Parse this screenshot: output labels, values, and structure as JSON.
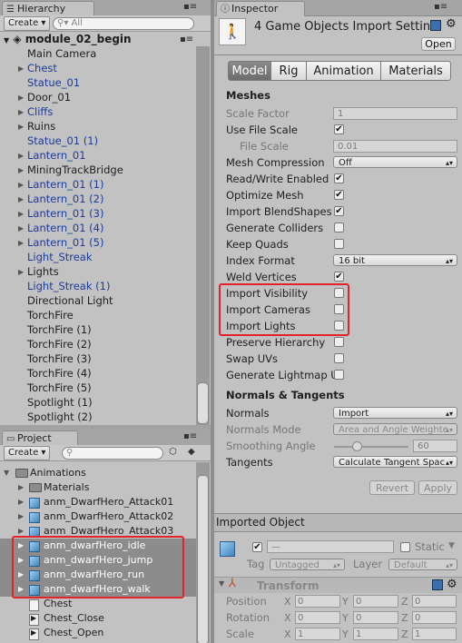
{
  "hierarchy": {
    "tab": "Hierarchy",
    "create": "Create",
    "search_placeholder": "All",
    "scene": "module_02_begin",
    "items": [
      {
        "label": "Main Camera",
        "blue": false,
        "arrow": false,
        "indent": 1
      },
      {
        "label": "Chest",
        "blue": true,
        "arrow": true,
        "indent": 1
      },
      {
        "label": "Statue_01",
        "blue": true,
        "arrow": false,
        "indent": 1
      },
      {
        "label": "Door_01",
        "blue": false,
        "arrow": true,
        "indent": 1
      },
      {
        "label": "Cliffs",
        "blue": true,
        "arrow": true,
        "indent": 1
      },
      {
        "label": "Ruins",
        "blue": false,
        "arrow": true,
        "indent": 1
      },
      {
        "label": "Statue_01 (1)",
        "blue": true,
        "arrow": false,
        "indent": 1
      },
      {
        "label": "Lantern_01",
        "blue": true,
        "arrow": true,
        "indent": 1
      },
      {
        "label": "MiningTrackBridge",
        "blue": false,
        "arrow": true,
        "indent": 1
      },
      {
        "label": "Lantern_01 (1)",
        "blue": true,
        "arrow": true,
        "indent": 1
      },
      {
        "label": "Lantern_01 (2)",
        "blue": true,
        "arrow": true,
        "indent": 1
      },
      {
        "label": "Lantern_01 (3)",
        "blue": true,
        "arrow": true,
        "indent": 1
      },
      {
        "label": "Lantern_01 (4)",
        "blue": true,
        "arrow": true,
        "indent": 1
      },
      {
        "label": "Lantern_01 (5)",
        "blue": true,
        "arrow": true,
        "indent": 1
      },
      {
        "label": "Light_Streak",
        "blue": true,
        "arrow": false,
        "indent": 1
      },
      {
        "label": "Lights",
        "blue": false,
        "arrow": true,
        "indent": 1
      },
      {
        "label": "Light_Streak (1)",
        "blue": true,
        "arrow": false,
        "indent": 1
      },
      {
        "label": "Directional Light",
        "blue": false,
        "arrow": false,
        "indent": 1
      },
      {
        "label": "TorchFire",
        "blue": false,
        "arrow": false,
        "indent": 1
      },
      {
        "label": "TorchFire (1)",
        "blue": false,
        "arrow": false,
        "indent": 1
      },
      {
        "label": "TorchFire (2)",
        "blue": false,
        "arrow": false,
        "indent": 1
      },
      {
        "label": "TorchFire (3)",
        "blue": false,
        "arrow": false,
        "indent": 1
      },
      {
        "label": "TorchFire (4)",
        "blue": false,
        "arrow": false,
        "indent": 1
      },
      {
        "label": "TorchFire (5)",
        "blue": false,
        "arrow": false,
        "indent": 1
      },
      {
        "label": "Spotlight (1)",
        "blue": false,
        "arrow": false,
        "indent": 1
      },
      {
        "label": "Spotlight (2)",
        "blue": false,
        "arrow": false,
        "indent": 1
      }
    ]
  },
  "project": {
    "tab": "Project",
    "create": "Create",
    "items": [
      {
        "label": "Animations",
        "kind": "folder",
        "arrow": "down",
        "selected": false
      },
      {
        "label": "Materials",
        "kind": "folder",
        "arrow": "right",
        "selected": false
      },
      {
        "label": "anm_DwarfHero_Attack01",
        "kind": "model",
        "arrow": "right",
        "selected": false
      },
      {
        "label": "anm_DwarfHero_Attack02",
        "kind": "model",
        "arrow": "right",
        "selected": false
      },
      {
        "label": "anm_DwarfHero_Attack03",
        "kind": "model",
        "arrow": "right",
        "selected": false
      },
      {
        "label": "anm_dwarfHero_idle",
        "kind": "model",
        "arrow": "right",
        "selected": true
      },
      {
        "label": "anm_dwarfHero_jump",
        "kind": "model",
        "arrow": "right",
        "selected": true
      },
      {
        "label": "anm_dwarfHero_run",
        "kind": "model",
        "arrow": "right",
        "selected": true
      },
      {
        "label": "anm_dwarfHero_walk",
        "kind": "model",
        "arrow": "right",
        "selected": true
      },
      {
        "label": "Chest",
        "kind": "doc",
        "arrow": "none",
        "selected": false
      },
      {
        "label": "Chest_Close",
        "kind": "anim",
        "arrow": "none",
        "selected": false
      },
      {
        "label": "Chest_Open",
        "kind": "anim",
        "arrow": "none",
        "selected": false
      }
    ]
  },
  "inspector": {
    "tab": "Inspector",
    "title": "4 Game Objects Import Settin",
    "open_button": "Open",
    "tabs": [
      "Model",
      "Rig",
      "Animation",
      "Materials"
    ],
    "active_tab": "Model",
    "meshes_header": "Meshes",
    "scale_factor_label": "Scale Factor",
    "scale_factor_value": "1",
    "use_file_scale_label": "Use File Scale",
    "file_scale_label": "File Scale",
    "file_scale_value": "0.01",
    "mesh_compression_label": "Mesh Compression",
    "mesh_compression_value": "Off",
    "read_write_label": "Read/Write Enabled",
    "optimize_mesh_label": "Optimize Mesh",
    "import_blendshapes_label": "Import BlendShapes",
    "generate_colliders_label": "Generate Colliders",
    "keep_quads_label": "Keep Quads",
    "index_format_label": "Index Format",
    "index_format_value": "16 bit",
    "weld_vertices_label": "Weld Vertices",
    "import_visibility_label": "Import Visibility",
    "import_cameras_label": "Import Cameras",
    "import_lights_label": "Import Lights",
    "preserve_hierarchy_label": "Preserve Hierarchy",
    "swap_uvs_label": "Swap UVs",
    "generate_lightmap_label": "Generate Lightmap U",
    "normals_header": "Normals & Tangents",
    "normals_label": "Normals",
    "normals_value": "Import",
    "normals_mode_label": "Normals Mode",
    "normals_mode_value": "Area and Angle Weighte",
    "smoothing_angle_label": "Smoothing Angle",
    "smoothing_angle_value": "60",
    "smoothing_angle_fraction": 0.333,
    "tangents_label": "Tangents",
    "tangents_value": "Calculate Tangent Spac",
    "revert": "Revert",
    "apply": "Apply"
  },
  "imported_object": {
    "header": "Imported Object",
    "name_placeholder": "—",
    "static_label": "Static",
    "tag_label": "Tag",
    "tag_value": "Untagged",
    "layer_label": "Layer",
    "layer_value": "Default",
    "transform_label": "Transform",
    "position_label": "Position",
    "rotation_label": "Rotation",
    "scale_label": "Scale",
    "position": [
      "0",
      "0",
      "0"
    ],
    "rotation": [
      "0",
      "0",
      "0"
    ],
    "scale": [
      "1",
      "1",
      "1"
    ],
    "axes": [
      "X",
      "Y",
      "Z"
    ]
  },
  "colors": {
    "highlight": "#e2232b",
    "prefab_blue": "#1c3b9e",
    "selection": "#8c8c8c"
  }
}
